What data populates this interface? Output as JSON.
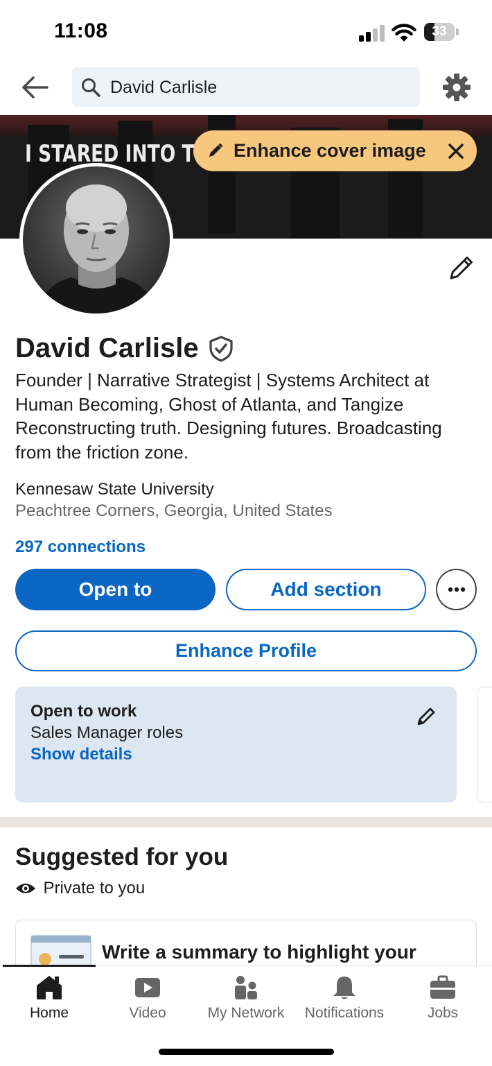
{
  "status_bar": {
    "time": "11:08",
    "battery_percent": "33",
    "battery_level": 0.33,
    "signal_bars_active": 2
  },
  "top_nav": {
    "search_value": "David Carlisle",
    "icons": [
      "back-arrow-icon",
      "search-icon",
      "gear-icon"
    ]
  },
  "cover": {
    "image_text": "I STARED INTO TH",
    "enhance_label": "Enhance cover image"
  },
  "profile": {
    "name": "David Carlisle",
    "headline": "Founder | Narrative Strategist | Systems Architect at Human Becoming, Ghost of Atlanta, and Tangize Reconstructing truth. Designing futures. Broadcasting from the friction zone.",
    "school": "Kennesaw State University",
    "location": "Peachtree Corners, Georgia, United States",
    "connections": "297 connections"
  },
  "actions": {
    "open_to": "Open to",
    "add_section": "Add section",
    "enhance_profile": "Enhance Profile"
  },
  "open_to_work": {
    "title": "Open to work",
    "roles": "Sales Manager roles",
    "link": "Show details"
  },
  "suggested": {
    "title": "Suggested for you",
    "visibility": "Private to you",
    "card_text": "Write a summary to highlight your"
  },
  "bottom_nav": {
    "items": [
      {
        "label": "Home",
        "icon": "home-icon",
        "active": true
      },
      {
        "label": "Video",
        "icon": "video-icon",
        "active": false
      },
      {
        "label": "My Network",
        "icon": "network-icon",
        "active": false
      },
      {
        "label": "Notifications",
        "icon": "bell-icon",
        "active": false
      },
      {
        "label": "Jobs",
        "icon": "briefcase-icon",
        "active": false
      }
    ]
  },
  "colors": {
    "brand_blue": "#0a66c2",
    "pill_yellow": "#f8c77e",
    "card_blue": "#dde7f1"
  }
}
